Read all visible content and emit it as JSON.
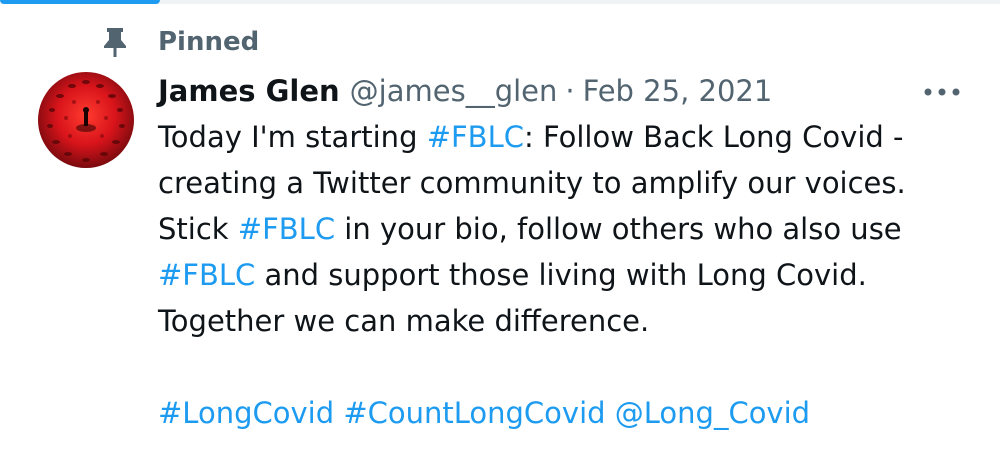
{
  "pinned_label": "Pinned",
  "author": {
    "display_name": "James Glen",
    "handle": "@james__glen",
    "separator": "·",
    "date": "Feb 25, 2021"
  },
  "tweet": {
    "line1": {
      "pre": "Today I'm starting ",
      "tag": "#FBLC",
      "post": ": Follow Back Long Covid -"
    },
    "line2": "creating a Twitter community to amplify our voices.",
    "line3": {
      "pre": "Stick ",
      "tag": "#FBLC",
      "post": " in your bio, follow others who also use"
    },
    "line4": {
      "tag": "#FBLC",
      "post": " and support those living with Long Covid."
    },
    "line5": "Together we can make difference.",
    "tags_line": {
      "tag1": "#LongCovid",
      "tag2": "#CountLongCovid",
      "mention": "@Long_Covid"
    }
  },
  "icons": {
    "pin": "pin-icon",
    "more": "more-options-icon",
    "avatar": "avatar-image"
  },
  "colors": {
    "link": "#1d9bf0",
    "secondary_text": "#536471",
    "primary_text": "#0f1419",
    "tab_accent": "#1d9bf0"
  }
}
